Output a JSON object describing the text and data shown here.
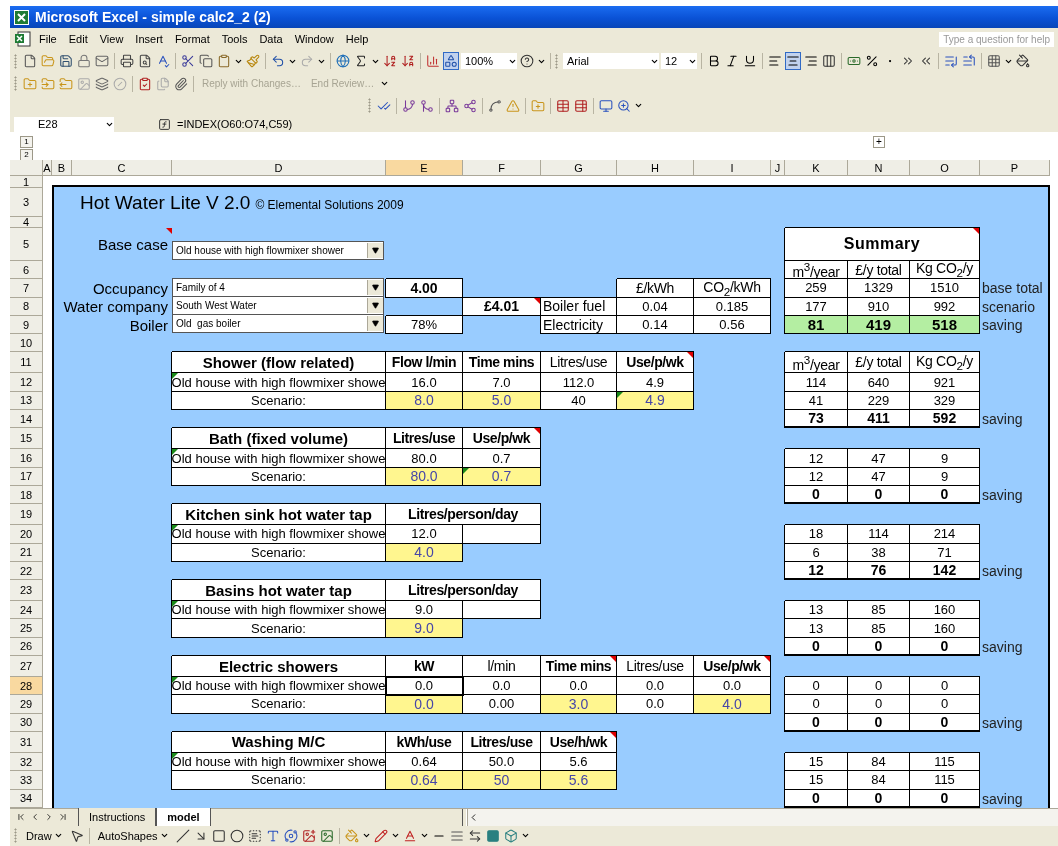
{
  "window": {
    "title": "Microsoft Excel - simple calc2_2 (2)"
  },
  "menu": {
    "items": [
      "File",
      "Edit",
      "View",
      "Insert",
      "Format",
      "Tools",
      "Data",
      "Window",
      "Help"
    ],
    "help_placeholder": "Type a question for help"
  },
  "standard_toolbar": {
    "zoom": "100%",
    "drawing_on": true
  },
  "formatting_toolbar": {
    "font": "Arial",
    "size": "12",
    "align_buttons": [
      {
        "selected": false
      },
      {
        "selected": true
      },
      {
        "selected": false
      }
    ]
  },
  "reviewing_toolbar": {
    "buttons": [
      {
        "label": "Reply with Changes…",
        "disabled": true
      },
      {
        "label": "End Review…",
        "disabled": true
      }
    ]
  },
  "formula_bar": {
    "name_box": "E28",
    "formula": "=INDEX(O60:O74,C59)"
  },
  "outline": {
    "levels": [
      "1",
      "2"
    ],
    "expand": "+"
  },
  "columns": [
    {
      "label": "A",
      "selected": false
    },
    {
      "label": "B",
      "selected": false
    },
    {
      "label": "C",
      "selected": false
    },
    {
      "label": "D",
      "selected": false
    },
    {
      "label": "E",
      "selected": true
    },
    {
      "label": "F",
      "selected": false
    },
    {
      "label": "G",
      "selected": false
    },
    {
      "label": "H",
      "selected": false
    },
    {
      "label": "I",
      "selected": false
    },
    {
      "label": "J",
      "selected": false
    },
    {
      "label": "K",
      "selected": false
    },
    {
      "label": "N",
      "selected": false
    },
    {
      "label": "O",
      "selected": false
    },
    {
      "label": "P",
      "selected": false
    }
  ],
  "rows": [
    {
      "label": "1",
      "selected": false,
      "cells": []
    },
    {
      "label": "3",
      "selected": false,
      "cells": [
        {
          "kind": "title",
          "text": "Hot Water Lite V 2.0",
          "subtitle": "© Elemental Solutions 2009"
        }
      ]
    },
    {
      "label": "4",
      "selected": false,
      "cells": []
    },
    {
      "label": "5",
      "selected": false,
      "cells": [
        {
          "kind": "label",
          "text": "Base case",
          "comment": true
        },
        {
          "kind": "dropdown",
          "text": "Old house with high flowmixer shower"
        },
        {
          "kind": "empty"
        },
        {
          "kind": "empty"
        },
        {
          "kind": "empty"
        },
        {
          "kind": "empty"
        },
        {
          "kind": "empty"
        },
        {
          "kind": "empty"
        },
        {
          "kind": "summary",
          "text": "Summary",
          "comment": true
        },
        {
          "kind": "merged"
        },
        {
          "kind": "merged"
        }
      ]
    },
    {
      "label": "6",
      "selected": false,
      "cells": [
        {
          "kind": "empty"
        },
        {
          "kind": "empty"
        },
        {
          "kind": "empty"
        },
        {
          "kind": "empty"
        },
        {
          "kind": "empty"
        },
        {
          "kind": "empty"
        },
        {
          "kind": "empty"
        },
        {
          "kind": "empty"
        },
        {
          "kind": "unit",
          "text": "m$^{3}$/year"
        },
        {
          "kind": "unit",
          "text": "£/y total"
        },
        {
          "kind": "unit",
          "text": "Kg CO$_{2}$/y"
        }
      ]
    },
    {
      "label": "7",
      "selected": false,
      "cells": [
        {
          "kind": "label",
          "text": "Occupancy"
        },
        {
          "kind": "dropdown",
          "text": "Family of 4"
        },
        {
          "kind": "result",
          "text": "4.00"
        },
        {
          "kind": "empty"
        },
        {
          "kind": "empty"
        },
        {
          "kind": "unit",
          "text": "£/kWh"
        },
        {
          "kind": "unit",
          "text": "CO$_{2}$/kWh"
        },
        {
          "kind": "empty"
        },
        {
          "kind": "value",
          "text": "259"
        },
        {
          "kind": "value",
          "text": "1329"
        },
        {
          "kind": "value",
          "text": "1510"
        },
        {
          "kind": "note",
          "text": "base total"
        }
      ]
    },
    {
      "label": "8",
      "selected": false,
      "cells": [
        {
          "kind": "label",
          "text": "Water company"
        },
        {
          "kind": "dropdown",
          "text": "South West Water"
        },
        {
          "kind": "empty"
        },
        {
          "kind": "result",
          "text": "£4.01",
          "comment": true
        },
        {
          "kind": "caption",
          "text": "Boiler fuel"
        },
        {
          "kind": "value",
          "text": "0.04"
        },
        {
          "kind": "value",
          "text": "0.185"
        },
        {
          "kind": "empty"
        },
        {
          "kind": "value",
          "text": "177"
        },
        {
          "kind": "value",
          "text": "910"
        },
        {
          "kind": "value",
          "text": "992"
        },
        {
          "kind": "note",
          "text": "scenario"
        }
      ]
    },
    {
      "label": "9",
      "selected": false,
      "cells": [
        {
          "kind": "label",
          "text": "Boiler"
        },
        {
          "kind": "dropdown",
          "text": "Old  gas boiler"
        },
        {
          "kind": "value",
          "text": "78%"
        },
        {
          "kind": "empty"
        },
        {
          "kind": "caption",
          "text": "Electricity"
        },
        {
          "kind": "value",
          "text": "0.14"
        },
        {
          "kind": "value",
          "text": "0.56"
        },
        {
          "kind": "empty"
        },
        {
          "kind": "highlight",
          "text": "81"
        },
        {
          "kind": "highlight",
          "text": "419"
        },
        {
          "kind": "highlight",
          "text": "518"
        },
        {
          "kind": "note",
          "text": "saving"
        }
      ]
    },
    {
      "label": "10",
      "selected": false,
      "cells": []
    },
    {
      "label": "11",
      "selected": false,
      "cells": [
        {
          "kind": "empty"
        },
        {
          "kind": "heading",
          "text": "Shower (flow related)"
        },
        {
          "kind": "header",
          "text": "Flow l/min"
        },
        {
          "kind": "header",
          "text": "Time mins"
        },
        {
          "kind": "unit",
          "text": "Litres/use"
        },
        {
          "kind": "header",
          "text": "Use/p/wk",
          "comment": true
        },
        {
          "kind": "empty"
        },
        {
          "kind": "empty"
        },
        {
          "kind": "unit",
          "text": "m$^{3}$/year"
        },
        {
          "kind": "unit",
          "text": "£/y total"
        },
        {
          "kind": "unit",
          "text": "Kg CO$_{2}$/y"
        }
      ]
    },
    {
      "label": "12",
      "selected": false,
      "cells": [
        {
          "kind": "empty"
        },
        {
          "kind": "value",
          "text": "Old house with high flowmixer showe",
          "error": true
        },
        {
          "kind": "value",
          "text": "16.0"
        },
        {
          "kind": "value",
          "text": "7.0"
        },
        {
          "kind": "value",
          "text": "112.0"
        },
        {
          "kind": "value",
          "text": "4.9"
        },
        {
          "kind": "empty"
        },
        {
          "kind": "empty"
        },
        {
          "kind": "value",
          "text": "114"
        },
        {
          "kind": "value",
          "text": "640"
        },
        {
          "kind": "value",
          "text": "921"
        }
      ]
    },
    {
      "label": "13",
      "selected": false,
      "cells": [
        {
          "kind": "empty"
        },
        {
          "kind": "value",
          "text": "Scenario:"
        },
        {
          "kind": "input",
          "text": "8.0"
        },
        {
          "kind": "input",
          "text": "5.0"
        },
        {
          "kind": "value",
          "text": "40"
        },
        {
          "kind": "input",
          "text": "4.9",
          "error": true
        },
        {
          "kind": "empty"
        },
        {
          "kind": "empty"
        },
        {
          "kind": "value",
          "text": "41"
        },
        {
          "kind": "value",
          "text": "229"
        },
        {
          "kind": "value",
          "text": "329"
        }
      ]
    },
    {
      "label": "14",
      "selected": false,
      "cells": [
        {
          "kind": "empty"
        },
        {
          "kind": "empty"
        },
        {
          "kind": "empty"
        },
        {
          "kind": "empty"
        },
        {
          "kind": "empty"
        },
        {
          "kind": "empty"
        },
        {
          "kind": "empty"
        },
        {
          "kind": "empty"
        },
        {
          "kind": "total",
          "text": "73"
        },
        {
          "kind": "total",
          "text": "411"
        },
        {
          "kind": "total",
          "text": "592"
        },
        {
          "kind": "note",
          "text": "saving"
        }
      ]
    },
    {
      "label": "15",
      "selected": false,
      "cells": [
        {
          "kind": "empty"
        },
        {
          "kind": "heading",
          "text": "Bath (fixed volume)"
        },
        {
          "kind": "header",
          "text": "Litres/use"
        },
        {
          "kind": "header",
          "text": "Use/p/wk",
          "comment": true
        }
      ]
    },
    {
      "label": "16",
      "selected": false,
      "cells": [
        {
          "kind": "empty"
        },
        {
          "kind": "value",
          "text": "Old house with high flowmixer showe",
          "error": true
        },
        {
          "kind": "value",
          "text": "80.0"
        },
        {
          "kind": "value",
          "text": "0.7"
        },
        {
          "kind": "empty"
        },
        {
          "kind": "empty"
        },
        {
          "kind": "empty"
        },
        {
          "kind": "empty"
        },
        {
          "kind": "value",
          "text": "12"
        },
        {
          "kind": "value",
          "text": "47"
        },
        {
          "kind": "value",
          "text": "9"
        }
      ]
    },
    {
      "label": "17",
      "selected": false,
      "cells": [
        {
          "kind": "empty"
        },
        {
          "kind": "value",
          "text": "Scenario:"
        },
        {
          "kind": "input",
          "text": "80.0"
        },
        {
          "kind": "input",
          "text": "0.7",
          "error": true
        },
        {
          "kind": "empty"
        },
        {
          "kind": "empty"
        },
        {
          "kind": "empty"
        },
        {
          "kind": "empty"
        },
        {
          "kind": "value",
          "text": "12"
        },
        {
          "kind": "value",
          "text": "47"
        },
        {
          "kind": "value",
          "text": "9"
        }
      ]
    },
    {
      "label": "18",
      "selected": false,
      "cells": [
        {
          "kind": "empty"
        },
        {
          "kind": "empty"
        },
        {
          "kind": "empty"
        },
        {
          "kind": "empty"
        },
        {
          "kind": "empty"
        },
        {
          "kind": "empty"
        },
        {
          "kind": "empty"
        },
        {
          "kind": "empty"
        },
        {
          "kind": "total",
          "text": "0"
        },
        {
          "kind": "total",
          "text": "0"
        },
        {
          "kind": "total",
          "text": "0"
        },
        {
          "kind": "note",
          "text": "saving"
        }
      ]
    },
    {
      "label": "19",
      "selected": false,
      "cells": [
        {
          "kind": "empty"
        },
        {
          "kind": "heading",
          "text": "Kitchen sink hot water tap"
        },
        {
          "kind": "header",
          "text": "Litres/person/day"
        },
        {
          "kind": "merged"
        }
      ]
    },
    {
      "label": "20",
      "selected": false,
      "cells": [
        {
          "kind": "empty"
        },
        {
          "kind": "value",
          "text": "Old house with high flowmixer showe",
          "error": true
        },
        {
          "kind": "value",
          "text": "12.0"
        },
        {
          "kind": "blank"
        },
        {
          "kind": "empty"
        },
        {
          "kind": "empty"
        },
        {
          "kind": "empty"
        },
        {
          "kind": "empty"
        },
        {
          "kind": "value",
          "text": "18"
        },
        {
          "kind": "value",
          "text": "114"
        },
        {
          "kind": "value",
          "text": "214"
        }
      ]
    },
    {
      "label": "21",
      "selected": false,
      "cells": [
        {
          "kind": "empty"
        },
        {
          "kind": "value",
          "text": "Scenario:"
        },
        {
          "kind": "input",
          "text": "4.0"
        },
        {
          "kind": "empty"
        },
        {
          "kind": "empty"
        },
        {
          "kind": "empty"
        },
        {
          "kind": "empty"
        },
        {
          "kind": "empty"
        },
        {
          "kind": "value",
          "text": "6"
        },
        {
          "kind": "value",
          "text": "38"
        },
        {
          "kind": "value",
          "text": "71"
        }
      ]
    },
    {
      "label": "22",
      "selected": false,
      "cells": [
        {
          "kind": "empty"
        },
        {
          "kind": "empty"
        },
        {
          "kind": "empty"
        },
        {
          "kind": "empty"
        },
        {
          "kind": "empty"
        },
        {
          "kind": "empty"
        },
        {
          "kind": "empty"
        },
        {
          "kind": "empty"
        },
        {
          "kind": "total",
          "text": "12"
        },
        {
          "kind": "total",
          "text": "76"
        },
        {
          "kind": "total",
          "text": "142"
        },
        {
          "kind": "note",
          "text": "saving"
        }
      ]
    },
    {
      "label": "23",
      "selected": false,
      "cells": [
        {
          "kind": "empty"
        },
        {
          "kind": "heading",
          "text": "Basins hot water tap"
        },
        {
          "kind": "header",
          "text": "Litres/person/day"
        },
        {
          "kind": "merged"
        }
      ]
    },
    {
      "label": "24",
      "selected": false,
      "cells": [
        {
          "kind": "empty"
        },
        {
          "kind": "value",
          "text": "Old house with high flowmixer showe",
          "error": true
        },
        {
          "kind": "value",
          "text": "9.0"
        },
        {
          "kind": "blank"
        },
        {
          "kind": "empty"
        },
        {
          "kind": "empty"
        },
        {
          "kind": "empty"
        },
        {
          "kind": "empty"
        },
        {
          "kind": "value",
          "text": "13"
        },
        {
          "kind": "value",
          "text": "85"
        },
        {
          "kind": "value",
          "text": "160"
        }
      ]
    },
    {
      "label": "25",
      "selected": false,
      "cells": [
        {
          "kind": "empty"
        },
        {
          "kind": "value",
          "text": "Scenario:"
        },
        {
          "kind": "input",
          "text": "9.0"
        },
        {
          "kind": "empty"
        },
        {
          "kind": "empty"
        },
        {
          "kind": "empty"
        },
        {
          "kind": "empty"
        },
        {
          "kind": "empty"
        },
        {
          "kind": "value",
          "text": "13"
        },
        {
          "kind": "value",
          "text": "85"
        },
        {
          "kind": "value",
          "text": "160"
        }
      ]
    },
    {
      "label": "26",
      "selected": false,
      "cells": [
        {
          "kind": "empty"
        },
        {
          "kind": "empty"
        },
        {
          "kind": "empty"
        },
        {
          "kind": "empty"
        },
        {
          "kind": "empty"
        },
        {
          "kind": "empty"
        },
        {
          "kind": "empty"
        },
        {
          "kind": "empty"
        },
        {
          "kind": "total",
          "text": "0"
        },
        {
          "kind": "total",
          "text": "0"
        },
        {
          "kind": "total",
          "text": "0"
        },
        {
          "kind": "note",
          "text": "saving"
        }
      ]
    },
    {
      "label": "27",
      "selected": false,
      "cells": [
        {
          "kind": "empty"
        },
        {
          "kind": "heading",
          "text": "Electric showers"
        },
        {
          "kind": "header",
          "text": "kW"
        },
        {
          "kind": "unit",
          "text": "l/min"
        },
        {
          "kind": "header",
          "text": "Time mins",
          "comment": true
        },
        {
          "kind": "unit",
          "text": "Litres/use"
        },
        {
          "kind": "header",
          "text": "Use/p/wk",
          "comment": true
        }
      ]
    },
    {
      "label": "28",
      "selected": true,
      "cells": [
        {
          "kind": "empty"
        },
        {
          "kind": "value",
          "text": "Old house with high flowmixer showe",
          "error": true
        },
        {
          "kind": "value",
          "text": "0.0"
        },
        {
          "kind": "value",
          "text": "0.0"
        },
        {
          "kind": "value",
          "text": "0.0"
        },
        {
          "kind": "value",
          "text": "0.0"
        },
        {
          "kind": "value",
          "text": "0.0"
        },
        {
          "kind": "empty"
        },
        {
          "kind": "value",
          "text": "0"
        },
        {
          "kind": "value",
          "text": "0"
        },
        {
          "kind": "value",
          "text": "0"
        }
      ]
    },
    {
      "label": "29",
      "selected": false,
      "cells": [
        {
          "kind": "empty"
        },
        {
          "kind": "value",
          "text": "Scenario:"
        },
        {
          "kind": "input",
          "text": "0.0"
        },
        {
          "kind": "value",
          "text": "0.00"
        },
        {
          "kind": "input",
          "text": "3.0"
        },
        {
          "kind": "value",
          "text": "0.0"
        },
        {
          "kind": "input",
          "text": "4.0"
        },
        {
          "kind": "empty"
        },
        {
          "kind": "value",
          "text": "0"
        },
        {
          "kind": "value",
          "text": "0"
        },
        {
          "kind": "value",
          "text": "0"
        }
      ]
    },
    {
      "label": "30",
      "selected": false,
      "cells": [
        {
          "kind": "empty"
        },
        {
          "kind": "empty"
        },
        {
          "kind": "empty"
        },
        {
          "kind": "empty"
        },
        {
          "kind": "empty"
        },
        {
          "kind": "empty"
        },
        {
          "kind": "empty"
        },
        {
          "kind": "empty"
        },
        {
          "kind": "total",
          "text": "0"
        },
        {
          "kind": "total",
          "text": "0"
        },
        {
          "kind": "total",
          "text": "0"
        },
        {
          "kind": "note",
          "text": "saving"
        }
      ]
    },
    {
      "label": "31",
      "selected": false,
      "cells": [
        {
          "kind": "empty"
        },
        {
          "kind": "heading",
          "text": "Washing M/C"
        },
        {
          "kind": "header",
          "text": "kWh/use"
        },
        {
          "kind": "header",
          "text": "Litres/use"
        },
        {
          "kind": "header",
          "text": "Use/h/wk",
          "comment": true
        }
      ]
    },
    {
      "label": "32",
      "selected": false,
      "cells": [
        {
          "kind": "empty"
        },
        {
          "kind": "value",
          "text": "Old house with high flowmixer showe",
          "error": true
        },
        {
          "kind": "value",
          "text": "0.64"
        },
        {
          "kind": "value",
          "text": "50.0"
        },
        {
          "kind": "value",
          "text": "5.6"
        },
        {
          "kind": "empty"
        },
        {
          "kind": "empty"
        },
        {
          "kind": "empty"
        },
        {
          "kind": "value",
          "text": "15"
        },
        {
          "kind": "value",
          "text": "84"
        },
        {
          "kind": "value",
          "text": "115"
        }
      ]
    },
    {
      "label": "33",
      "selected": false,
      "cells": [
        {
          "kind": "empty"
        },
        {
          "kind": "value",
          "text": "Scenario:"
        },
        {
          "kind": "input",
          "text": "0.64"
        },
        {
          "kind": "input",
          "text": "50"
        },
        {
          "kind": "input",
          "text": "5.6"
        },
        {
          "kind": "empty"
        },
        {
          "kind": "empty"
        },
        {
          "kind": "empty"
        },
        {
          "kind": "value",
          "text": "15"
        },
        {
          "kind": "value",
          "text": "84"
        },
        {
          "kind": "value",
          "text": "115"
        }
      ]
    },
    {
      "label": "34",
      "selected": false,
      "cells": [
        {
          "kind": "empty"
        },
        {
          "kind": "empty"
        },
        {
          "kind": "empty"
        },
        {
          "kind": "empty"
        },
        {
          "kind": "empty"
        },
        {
          "kind": "empty"
        },
        {
          "kind": "empty"
        },
        {
          "kind": "empty"
        },
        {
          "kind": "total",
          "text": "0"
        },
        {
          "kind": "total",
          "text": "0"
        },
        {
          "kind": "total",
          "text": "0"
        },
        {
          "kind": "note",
          "text": "saving"
        }
      ]
    }
  ],
  "sheet_tabs": [
    {
      "label": "Instructions",
      "selected": false
    },
    {
      "label": "model",
      "selected": true
    }
  ],
  "drawing_toolbar": {
    "draw": "Draw",
    "autoshapes": "AutoShapes"
  }
}
